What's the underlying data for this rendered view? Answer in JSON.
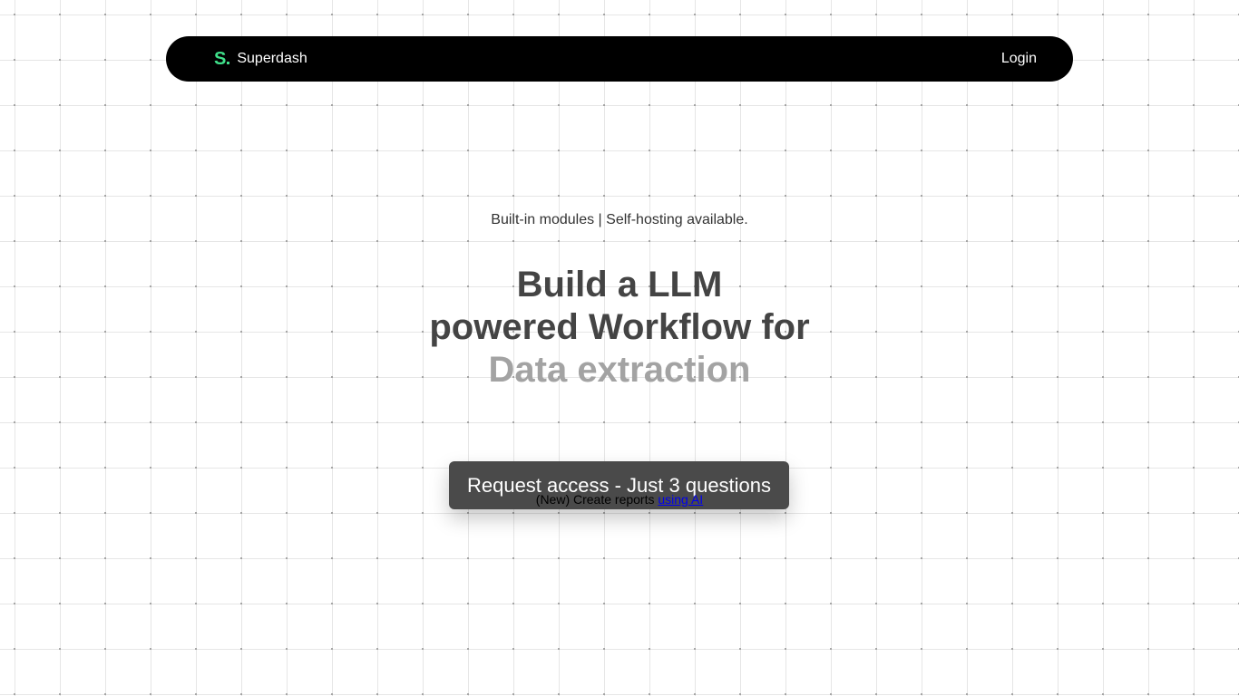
{
  "nav": {
    "logo_letter": "S",
    "brand_name": "Superdash",
    "login_label": "Login"
  },
  "hero": {
    "tagline": "Built-in modules | Self-hosting available.",
    "headline_line1": "Build a LLM",
    "headline_line2": "powered Workflow for",
    "headline_rotating": "Data extraction",
    "cta_label": "Request access - Just 3 questions",
    "note_text": "(New) Create reports",
    "note_link": "using AI"
  },
  "colors": {
    "nav_background": "#000000",
    "logo_accent": "#3fe08a",
    "cta_background": "#4a4a4a",
    "headline": "#444444",
    "rotating_word": "#a3a3a3",
    "link": "#0000ee"
  }
}
